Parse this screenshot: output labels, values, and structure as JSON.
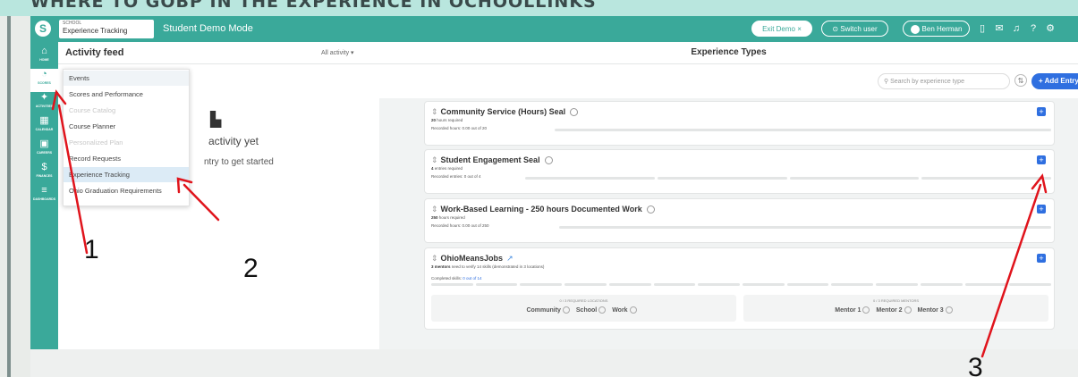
{
  "banner": {
    "title": "WHERE TO GOBP IN THE EXPERIENCE IN OCHOOLLINKS"
  },
  "header": {
    "app_chip_small": "SCHOOL",
    "app_chip_main": "Experience Tracking",
    "mode": "Student Demo Mode",
    "exit_demo": "Exit Demo ×",
    "switch_user": "⊙ Switch user",
    "user_name": "Ben Herman",
    "icons": [
      "document-icon",
      "mail-icon",
      "bell-icon",
      "help-icon",
      "settings-icon"
    ]
  },
  "sidebar": {
    "items": [
      {
        "label": "HOME",
        "icon": "home-icon"
      },
      {
        "label": "SCORES",
        "icon": "scores-icon"
      },
      {
        "label": "ACTIVITIES",
        "icon": "activities-icon"
      },
      {
        "label": "CALENDAR",
        "icon": "calendar-icon"
      },
      {
        "label": "CAREERS",
        "icon": "careers-icon"
      },
      {
        "label": "FINANCES",
        "icon": "finances-icon"
      },
      {
        "label": "DASHBOARDS",
        "icon": "dashboards-icon"
      }
    ]
  },
  "activity_feed": {
    "title": "Activity feed",
    "filter": "All activity ▾",
    "empty_title": "activity yet",
    "empty_sub": "ntry to get started"
  },
  "dropdown": {
    "items": [
      {
        "label": "Events",
        "state": "normal"
      },
      {
        "label": "Scores and Performance",
        "state": "normal"
      },
      {
        "label": "Course Catalog",
        "state": "disabled"
      },
      {
        "label": "Course Planner",
        "state": "normal"
      },
      {
        "label": "Personalized Plan",
        "state": "disabled"
      },
      {
        "label": "Record Requests",
        "state": "normal"
      },
      {
        "label": "Experience Tracking",
        "state": "highlight"
      },
      {
        "label": "Ohio Graduation Requirements",
        "state": "normal"
      }
    ]
  },
  "experience": {
    "title": "Experience Types",
    "search_placeholder": "Search by experience type",
    "add_entry": "+ Add Entry",
    "cards": [
      {
        "title": "Community Service (Hours) Seal",
        "req_bold": "20",
        "req": "hours required",
        "progress": "Recorded hours: 0.00 out of 20",
        "segments": 0
      },
      {
        "title": "Student Engagement Seal",
        "req_bold": "4",
        "req": "entries required",
        "progress": "Recorded entries: 0 out of 4",
        "segments": 4
      },
      {
        "title": "Work-Based Learning - 250 hours Documented Work",
        "req_bold": "250",
        "req": "hours required",
        "progress": "Recorded hours: 0.00 out of 250",
        "segments": 0
      },
      {
        "title": "OhioMeansJobs",
        "req_bold": "3 mentors",
        "req": "need to verify 14 skills (demonstrated in 3 locations)",
        "progress": "Completed skills:",
        "progress_link": "0 out of 14",
        "segments": 14
      }
    ],
    "locations": {
      "head": "0 / 3 REQUIRED LOCATIONS",
      "items": [
        "Community",
        "School",
        "Work"
      ]
    },
    "mentors": {
      "head": "0 / 3 REQUIRED MENTORS",
      "items": [
        "Mentor 1",
        "Mentor 2",
        "Mentor 3"
      ]
    }
  },
  "annotations": {
    "labels": [
      "1",
      "2",
      "3"
    ],
    "color": "#e0141c"
  },
  "colors": {
    "teal": "#3aa99a",
    "blue": "#2f6fe0",
    "banner": "#b9e6de"
  }
}
